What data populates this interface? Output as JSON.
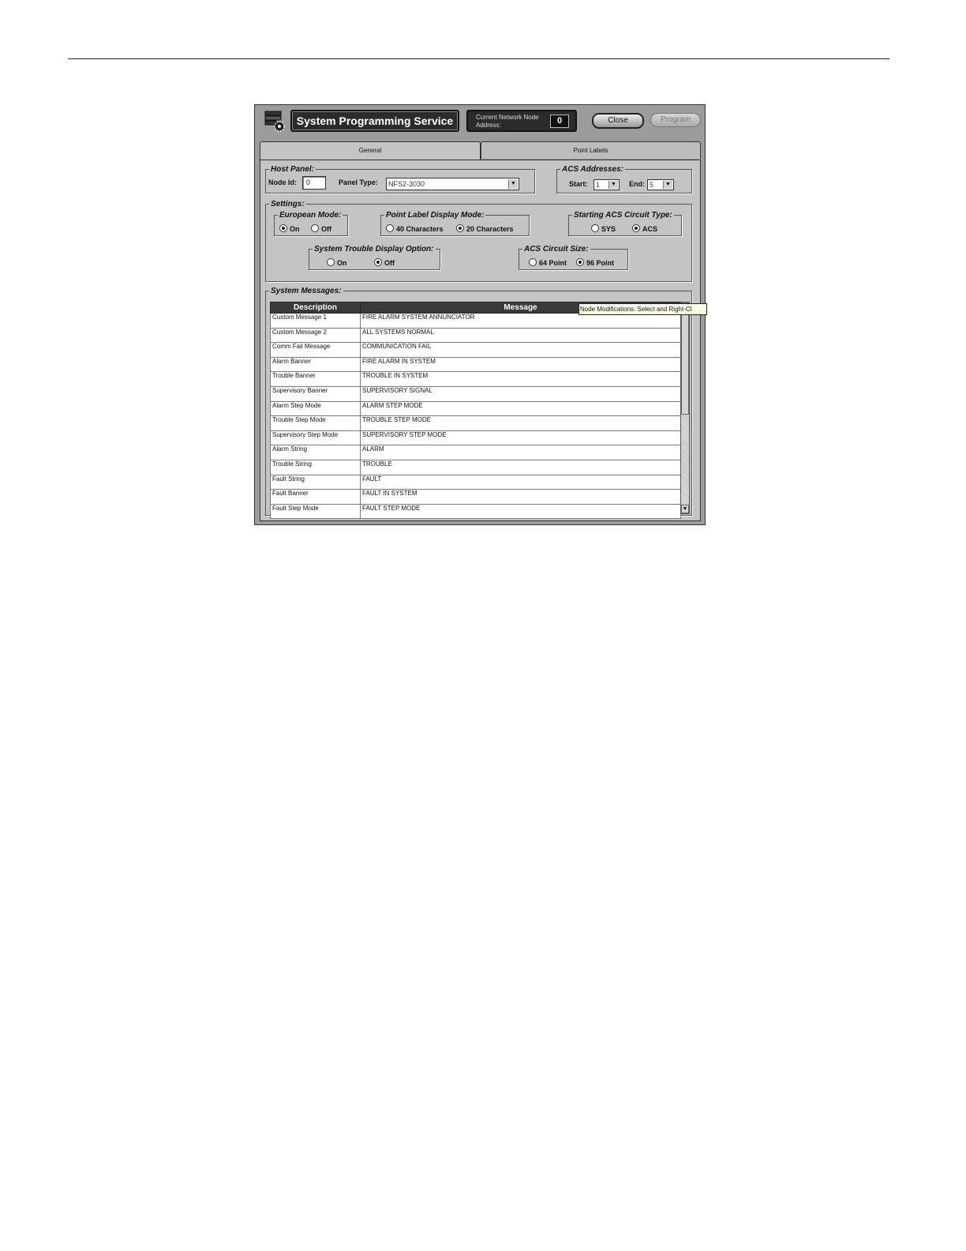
{
  "window": {
    "title": "System Programming Service",
    "network": {
      "label": "Current Network Node Address:",
      "value": "0"
    },
    "buttons": {
      "close": "Close",
      "program": "Program"
    }
  },
  "tabs": [
    {
      "label": "General"
    },
    {
      "label": "Point Labels"
    }
  ],
  "host_panel": {
    "legend": "Host Panel:",
    "node_id_label": "Node Id:",
    "node_id_value": "0",
    "panel_type_label": "Panel Type:",
    "panel_type_value": "NFS2-3030"
  },
  "acs_addresses": {
    "legend": "ACS Addresses:",
    "start_label": "Start:",
    "start_value": "1",
    "end_label": "End:",
    "end_value": "5"
  },
  "settings": {
    "legend": "Settings:",
    "european_mode": {
      "legend": "European Mode:",
      "options": [
        "On",
        "Off"
      ],
      "selected": "On"
    },
    "point_label_display_mode": {
      "legend": "Point Label Display Mode:",
      "options": [
        "40 Characters",
        "20 Characters"
      ],
      "selected": "20 Characters"
    },
    "starting_acs_circuit_type": {
      "legend": "Starting ACS Circuit Type:",
      "options": [
        "SYS",
        "ACS"
      ],
      "selected": "ACS"
    },
    "system_trouble_display_option": {
      "legend": "System Trouble Display Option:",
      "options": [
        "On",
        "Off"
      ],
      "selected": "Off"
    },
    "acs_circuit_size": {
      "legend": "ACS Circuit Size:",
      "options": [
        "64 Point",
        "96 Point"
      ],
      "selected": "96 Point"
    }
  },
  "system_messages": {
    "legend": "System Messages:",
    "columns": [
      "Description",
      "Message"
    ],
    "rows": [
      [
        "Custom Message 1",
        "FIRE ALARM SYSTEM ANNUNCIATOR"
      ],
      [
        "Custom Message 2",
        "ALL SYSTEMS NORMAL"
      ],
      [
        "Comm Fail Message",
        "COMMUNICATION FAIL"
      ],
      [
        "Alarm Banner",
        "FIRE ALARM IN SYSTEM"
      ],
      [
        "Trouble Banner",
        "TROUBLE IN SYSTEM"
      ],
      [
        "Supervisory Banner",
        "SUPERVISORY SIGNAL"
      ],
      [
        "Alarm Step Mode",
        "ALARM STEP MODE"
      ],
      [
        "Trouble Step Mode",
        "TROUBLE STEP MODE"
      ],
      [
        "Supervisory Step Mode",
        "SUPERVISORY STEP MODE"
      ],
      [
        "Alarm String",
        "ALARM"
      ],
      [
        "Trouble String",
        "TROUBLE"
      ],
      [
        "Fault String",
        "FAULT"
      ],
      [
        "Fault Banner",
        "FAULT IN SYSTEM"
      ],
      [
        "Fault Step Mode",
        "FAULT STEP MODE"
      ]
    ]
  },
  "tooltip": "Node Modifications: Select and Right-Cl",
  "icons": {
    "app": "system-programming-gear-icon",
    "dropdown": "chevron-down-icon",
    "scroll_up": "scroll-up-arrow-icon",
    "scroll_down": "scroll-down-arrow-icon"
  }
}
